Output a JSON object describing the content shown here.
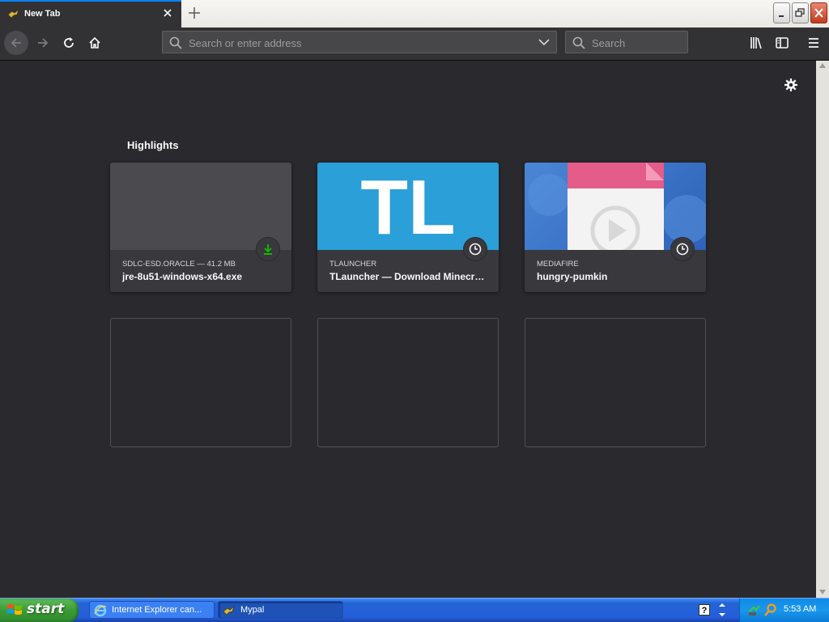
{
  "browser": {
    "tab": {
      "title": "New Tab"
    },
    "urlbar": {
      "placeholder": "Search or enter address",
      "value": ""
    },
    "searchbar": {
      "placeholder": "Search"
    }
  },
  "content": {
    "section_title": "Highlights",
    "highlights": [
      {
        "source": "SDLC-ESD.ORACLE — 41.2 MB",
        "title": "jre-8u51-windows-x64.exe",
        "badge": "download-icon",
        "badge_color": "#12bc00"
      },
      {
        "source": "TLAUNCHER",
        "title": "TLauncher — Download Minecr…",
        "badge": "clock-icon",
        "thumb_text": "TL",
        "thumb_color": "#2a9fd8"
      },
      {
        "source": "MEDIAFIRE",
        "title": "hungry-pumkin",
        "badge": "clock-icon",
        "thumb_color": "#3b76c8"
      }
    ],
    "empty_slots": 3
  },
  "taskbar": {
    "start_label": "start",
    "tasks": [
      {
        "label": "Internet Explorer can...",
        "icon": "ie-icon"
      },
      {
        "label": "Mypal",
        "icon": "mypal-icon"
      }
    ],
    "clock": "5:53 AM"
  },
  "colors": {
    "background": "#2a2a2e",
    "toolbar": "#323234",
    "accent": "#0a84ff"
  }
}
